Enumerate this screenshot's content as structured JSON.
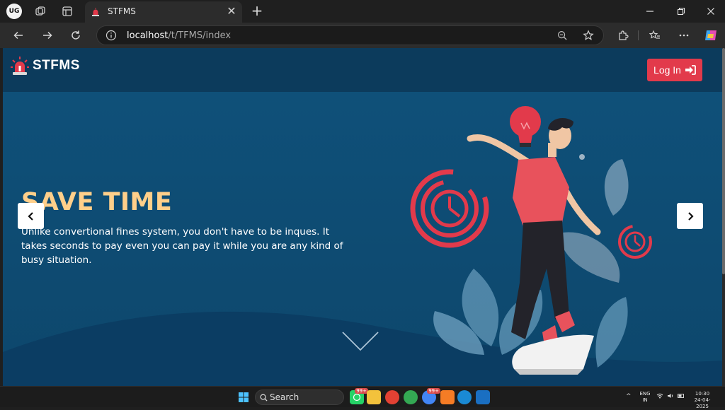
{
  "browser": {
    "profile_initials": "UG",
    "tab": {
      "title": "STFMS",
      "close_glyph": "✕"
    },
    "new_tab_glyph": "+",
    "address": {
      "host": "localhost",
      "path": "/t/TFMS/index"
    },
    "icons": [
      "workspaces-icon",
      "tab-actions-icon",
      "back-icon",
      "forward-icon",
      "refresh-icon",
      "site-info-icon",
      "zoom-icon",
      "favorite-star-icon",
      "extensions-icon",
      "favorites-icon",
      "more-icon",
      "copilot-icon"
    ]
  },
  "site": {
    "brand": "STFMS",
    "login_label": "Log In",
    "hero": {
      "title": "SAVE TIME",
      "text": "Unlike convertional fines system, you don't have to be inques. It takes seconds to pay even you can pay it while you are any kind of busy situation."
    },
    "colors": {
      "header": "#0c3b5c",
      "hero": "#0e4a6e",
      "accent": "#e23a4b",
      "title": "#ffcf8a"
    }
  },
  "taskbar": {
    "search_label": "Search",
    "badge_count": "99+",
    "tray": {
      "lang_top": "ENG",
      "lang_bottom": "IN",
      "time": "10:30",
      "date": "24-04-2025"
    }
  }
}
